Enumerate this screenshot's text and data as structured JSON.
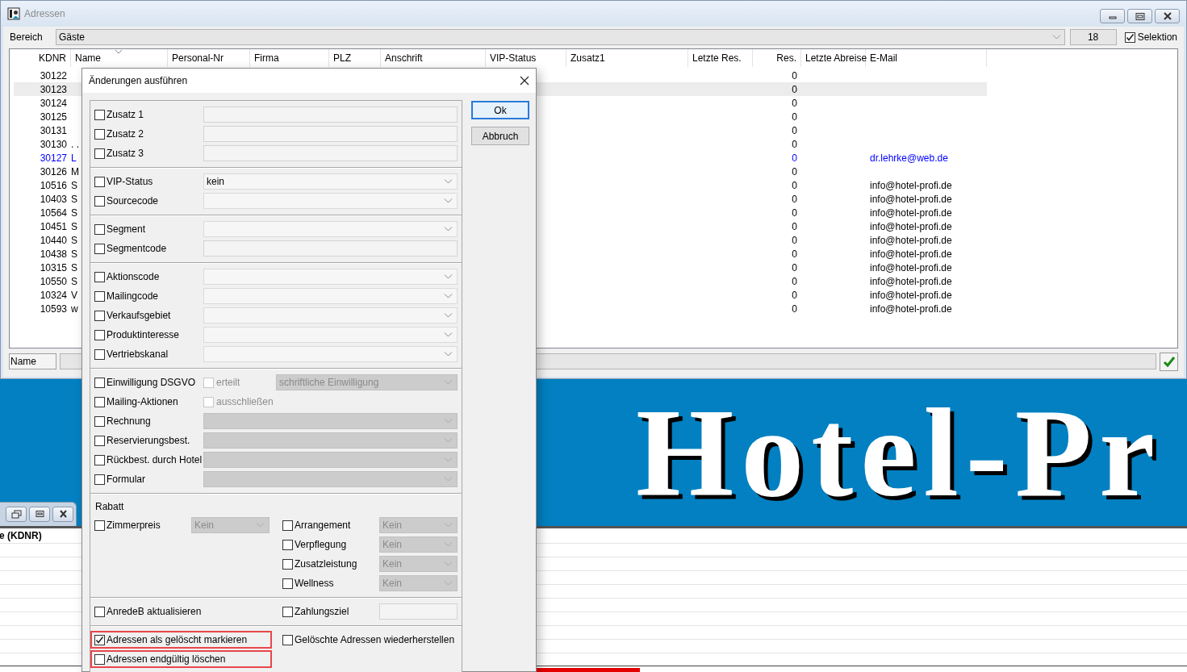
{
  "window": {
    "title": "Adressen",
    "active": false
  },
  "toolbar": {
    "area_label": "Bereich",
    "area_value": "Gäste",
    "count": "18",
    "selection": {
      "label": "Selektion",
      "checked": true
    }
  },
  "table": {
    "columns": [
      {
        "label": "KDNR",
        "sorted": false
      },
      {
        "label": "Name",
        "sorted": true
      },
      {
        "label": "Personal-Nr",
        "sorted": false
      },
      {
        "label": "Firma",
        "sorted": false
      },
      {
        "label": "PLZ",
        "sorted": false
      },
      {
        "label": "Anschrift",
        "sorted": false
      },
      {
        "label": "VIP-Status",
        "sorted": false
      },
      {
        "label": "Zusatz1",
        "sorted": false
      },
      {
        "label": "Letzte Res.",
        "sorted": false
      },
      {
        "label": "Res.",
        "sorted": false
      },
      {
        "label": "Letzte Abreise",
        "sorted": false
      },
      {
        "label": "E-Mail",
        "sorted": false
      }
    ],
    "rows": [
      {
        "kdnr": "30122",
        "res": "0",
        "selected": false,
        "color": "#000000"
      },
      {
        "kdnr": "30123",
        "res": "0",
        "selected": true,
        "color": "#000000"
      },
      {
        "kdnr": "30124",
        "res": "0",
        "selected": false,
        "color": "#000000"
      },
      {
        "kdnr": "30125",
        "res": "0",
        "selected": false,
        "color": "#000000"
      },
      {
        "kdnr": "30131",
        "res": "0",
        "selected": false,
        "color": "#000000"
      },
      {
        "kdnr": "30130",
        "name": ". .",
        "res": "0",
        "selected": false,
        "color": "#000000"
      },
      {
        "kdnr": "30127",
        "name": "L",
        "res": "0",
        "email": "dr.lehrke@web.de",
        "selected": false,
        "color": "#0000ff"
      },
      {
        "kdnr": "30126",
        "name": "M",
        "res": "0",
        "selected": false,
        "color": "#000000"
      },
      {
        "kdnr": "10516",
        "name": "S",
        "res": "0",
        "email": "info@hotel-profi.de",
        "selected": false,
        "color": "#000000"
      },
      {
        "kdnr": "10403",
        "name": "S",
        "res": "0",
        "email": "info@hotel-profi.de",
        "selected": false,
        "color": "#000000"
      },
      {
        "kdnr": "10564",
        "name": "S",
        "res": "0",
        "email": "info@hotel-profi.de",
        "selected": false,
        "color": "#000000"
      },
      {
        "kdnr": "10451",
        "name": "S",
        "res": "0",
        "email": "info@hotel-profi.de",
        "selected": false,
        "color": "#000000"
      },
      {
        "kdnr": "10440",
        "name": "S",
        "res": "0",
        "email": "info@hotel-profi.de",
        "selected": false,
        "color": "#000000"
      },
      {
        "kdnr": "10438",
        "name": "S",
        "res": "0",
        "email": "info@hotel-profi.de",
        "selected": false,
        "color": "#000000"
      },
      {
        "kdnr": "10315",
        "name": "S",
        "res": "0",
        "email": "info@hotel-profi.de",
        "selected": false,
        "color": "#000000"
      },
      {
        "kdnr": "10550",
        "name": "S",
        "res": "0",
        "email": "info@hotel-profi.de",
        "selected": false,
        "color": "#000000"
      },
      {
        "kdnr": "10324",
        "name": "V",
        "res": "0",
        "email": "info@hotel-profi.de",
        "selected": false,
        "color": "#000000"
      },
      {
        "kdnr": "10593",
        "name": "w",
        "res": "0",
        "email": "info@hotel-profi.de",
        "selected": false,
        "color": "#000000"
      }
    ]
  },
  "filter": {
    "label": "Name"
  },
  "banner": {
    "text": "Hotel-Pr"
  },
  "lower_window": {
    "column_header": "e (KDNR)"
  },
  "dialog": {
    "title": "Änderungen ausführen",
    "buttons": [
      {
        "label": "Ok",
        "default": true
      },
      {
        "label": "Abbruch",
        "default": false
      }
    ],
    "sections": [
      {
        "kind": "list",
        "rows": [
          {
            "label": "Zusatz 1",
            "checked": false,
            "control": {
              "kind": "text",
              "disabled": false
            }
          },
          {
            "label": "Zusatz 2",
            "checked": false,
            "control": {
              "kind": "text",
              "disabled": false
            }
          },
          {
            "label": "Zusatz 3",
            "checked": false,
            "control": {
              "kind": "text",
              "disabled": false
            }
          }
        ]
      },
      {
        "kind": "list",
        "rows": [
          {
            "label": "VIP-Status",
            "checked": false,
            "control": {
              "kind": "combo",
              "value": "kein",
              "disabled": false
            }
          },
          {
            "label": "Sourcecode",
            "checked": false,
            "control": {
              "kind": "combo",
              "disabled": false
            }
          }
        ]
      },
      {
        "kind": "list",
        "rows": [
          {
            "label": "Segment",
            "checked": false,
            "control": {
              "kind": "combo",
              "disabled": false
            }
          },
          {
            "label": "Segmentcode",
            "checked": false,
            "control": {
              "kind": "text",
              "disabled": false
            }
          }
        ]
      },
      {
        "kind": "list",
        "rows": [
          {
            "label": "Aktionscode",
            "checked": false,
            "control": {
              "kind": "combo",
              "disabled": false
            }
          },
          {
            "label": "Mailingcode",
            "checked": false,
            "control": {
              "kind": "combo",
              "disabled": false
            }
          },
          {
            "label": "Verkaufsgebiet",
            "checked": false,
            "control": {
              "kind": "combo",
              "disabled": false
            }
          },
          {
            "label": "Produktinteresse",
            "checked": false,
            "control": {
              "kind": "combo",
              "disabled": false
            }
          },
          {
            "label": "Vertriebskanal",
            "checked": false,
            "control": {
              "kind": "combo",
              "disabled": false
            }
          }
        ]
      },
      {
        "kind": "list",
        "rows": [
          {
            "label": "Einwilligung DSGVO",
            "checked": false,
            "option": {
              "label": "erteilt",
              "checked": false,
              "disabled": true
            },
            "control": {
              "kind": "combo",
              "value": "schriftliche Einwilligung",
              "disabled": true
            }
          },
          {
            "label": "Mailing-Aktionen",
            "checked": false,
            "option": {
              "label": "ausschließen",
              "checked": false,
              "disabled": true
            }
          },
          {
            "label": "Rechnung",
            "checked": false,
            "control": {
              "kind": "combo",
              "disabled": true
            }
          },
          {
            "label": "Reservierungsbest.",
            "checked": false,
            "control": {
              "kind": "combo",
              "disabled": true
            }
          },
          {
            "label": "Rückbest. durch Hotel",
            "checked": false,
            "control": {
              "kind": "combo",
              "disabled": true
            }
          },
          {
            "label": "Formular",
            "checked": false,
            "control": {
              "kind": "combo",
              "disabled": true
            }
          }
        ]
      },
      {
        "kind": "pairs",
        "heading": "Rabatt",
        "rows": [
          {
            "left": {
              "label": "Zimmerpreis",
              "checked": false,
              "control": {
                "kind": "combo",
                "value": "Kein",
                "disabled": true
              }
            },
            "right": {
              "label": "Arrangement",
              "checked": false,
              "control": {
                "kind": "combo",
                "value": "Kein",
                "disabled": true
              }
            }
          },
          {
            "right": {
              "label": "Verpflegung",
              "checked": false,
              "control": {
                "kind": "combo",
                "value": "Kein",
                "disabled": true
              }
            }
          },
          {
            "right": {
              "label": "Zusatzleistung",
              "checked": false,
              "control": {
                "kind": "combo",
                "value": "Kein",
                "disabled": true
              }
            }
          },
          {
            "right": {
              "label": "Wellness",
              "checked": false,
              "control": {
                "kind": "combo",
                "value": "Kein",
                "disabled": true
              }
            }
          }
        ]
      },
      {
        "kind": "pairs",
        "rows": [
          {
            "left": {
              "label": "AnredeB aktualisieren",
              "checked": false
            },
            "right": {
              "label": "Zahlungsziel",
              "checked": false,
              "control": {
                "kind": "text",
                "disabled": false
              }
            }
          }
        ]
      },
      {
        "kind": "pairs",
        "rows": [
          {
            "left": {
              "label": "Adressen als gelöscht markieren",
              "checked": true,
              "highlighted": true
            },
            "right": {
              "label": "Gelöschte Adressen wiederherstellen",
              "checked": false
            }
          },
          {
            "left": {
              "label": "Adressen endgültig löschen",
              "checked": false,
              "highlighted": true
            }
          }
        ]
      }
    ]
  }
}
